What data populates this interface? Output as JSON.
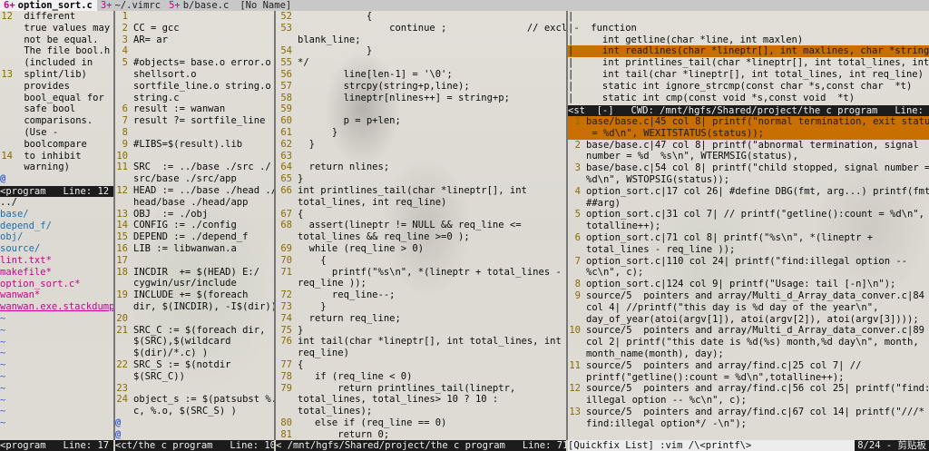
{
  "tabline": {
    "tabs": [
      {
        "num": "6+",
        "label": "option_sort.c",
        "selected": true
      },
      {
        "num": "3+",
        "label": "~/.vimrc",
        "selected": false
      },
      {
        "num": "5+",
        "label": "b/base.c",
        "selected": false
      },
      {
        "num": "",
        "label": "[No Name]",
        "selected": false
      }
    ]
  },
  "pane_doc": {
    "lines": [
      {
        "ln": "12",
        "text": " different"
      },
      {
        "ln": "",
        "text": " true values may"
      },
      {
        "ln": "",
        "text": " not be equal."
      },
      {
        "ln": "",
        "text": " The file bool.h"
      },
      {
        "ln": "",
        "text": " (included in"
      },
      {
        "ln": "13",
        "text": " splint/lib)"
      },
      {
        "ln": "",
        "text": " provides"
      },
      {
        "ln": "",
        "text": " bool_equal for"
      },
      {
        "ln": "",
        "text": " safe bool"
      },
      {
        "ln": "",
        "text": " comparisons."
      },
      {
        "ln": "",
        "text": " (Use -"
      },
      {
        "ln": "",
        "text": " boolcompare"
      },
      {
        "ln": "14",
        "text": " to inhibit"
      },
      {
        "ln": "",
        "text": " warning)"
      }
    ],
    "filler": "@",
    "status": "<program   Line: 12"
  },
  "pane_files": {
    "entries": [
      {
        "text": "../",
        "kind": "up"
      },
      {
        "text": "base/",
        "kind": "dir"
      },
      {
        "text": "depend_f/",
        "kind": "dir"
      },
      {
        "text": "obj/",
        "kind": "dir"
      },
      {
        "text": "source/",
        "kind": "dir"
      },
      {
        "text": "lint.txt*",
        "kind": "file"
      },
      {
        "text": "makefile*",
        "kind": "file"
      },
      {
        "text": "option_sort.c*",
        "kind": "file"
      },
      {
        "text": "wanwan*",
        "kind": "file"
      },
      {
        "text": "wanwan.exe.stackdump",
        "kind": "file-ul"
      }
    ],
    "tilde": "~",
    "status": "<program   Line: 17"
  },
  "pane_makefile": {
    "lines": [
      {
        "ln": "1",
        "text": ""
      },
      {
        "ln": "2",
        "text": "CC = gcc"
      },
      {
        "ln": "3",
        "text": "AR= ar"
      },
      {
        "ln": "4",
        "text": ""
      },
      {
        "ln": "5",
        "text": "#objects= base.o error.o"
      },
      {
        "ln": "",
        "text": "shellsort.o"
      },
      {
        "ln": "",
        "text": "sortfile_line.o string.o"
      },
      {
        "ln": "",
        "text": "string.c"
      },
      {
        "ln": "6",
        "text": "result := wanwan"
      },
      {
        "ln": "7",
        "text": "result ?= sortfile_line"
      },
      {
        "ln": "8",
        "text": ""
      },
      {
        "ln": "9",
        "text": "#LIBS=$(result).lib"
      },
      {
        "ln": "10",
        "text": ""
      },
      {
        "ln": "11",
        "text": "SRC  := ../base ./src ./"
      },
      {
        "ln": "",
        "text": "src/base ./src/app"
      },
      {
        "ln": "12",
        "text": "HEAD := ../base ./head ./"
      },
      {
        "ln": "",
        "text": "head/base ./head/app"
      },
      {
        "ln": "13",
        "text": "OBJ  := ./obj"
      },
      {
        "ln": "14",
        "text": "CONFIG := ./config"
      },
      {
        "ln": "15",
        "text": "DEPEND := ./depend_f"
      },
      {
        "ln": "16",
        "text": "LIB := libwanwan.a"
      },
      {
        "ln": "17",
        "text": ""
      },
      {
        "ln": "18",
        "text": "INCDIR  += $(HEAD) E:/"
      },
      {
        "ln": "",
        "text": "cygwin/usr/include"
      },
      {
        "ln": "19",
        "text": "INCLUDE += $(foreach"
      },
      {
        "ln": "",
        "text": "dir, $(INCDIR), -I$(dir))"
      },
      {
        "ln": "20",
        "text": ""
      },
      {
        "ln": "21",
        "text": "SRC_C := $(foreach dir,"
      },
      {
        "ln": "",
        "text": "$(SRC),$(wildcard"
      },
      {
        "ln": "",
        "text": "$(dir)/*.c) )"
      },
      {
        "ln": "22",
        "text": "SRC_S := $(notdir"
      },
      {
        "ln": "",
        "text": "$(SRC_C))"
      },
      {
        "ln": "23",
        "text": ""
      },
      {
        "ln": "24",
        "text": "object_s := $(patsubst %."
      },
      {
        "ln": "",
        "text": "c, %.o, $(SRC_S) )"
      }
    ],
    "filler": "@",
    "status": "<ct/the c program   Line: 10"
  },
  "pane_code": {
    "lines": [
      {
        "ln": "52",
        "text": "            {"
      },
      {
        "ln": "53",
        "text": "                continue ;              // exclude"
      },
      {
        "ln": "",
        "text": "blank_line;"
      },
      {
        "ln": "54",
        "text": "            }"
      },
      {
        "ln": "55",
        "text": "*/"
      },
      {
        "ln": "56",
        "text": "        line[len-1] = '\\0';"
      },
      {
        "ln": "57",
        "text": "        strcpy(string+p,line);"
      },
      {
        "ln": "58",
        "text": "        lineptr[nlines++] = string+p;"
      },
      {
        "ln": "59",
        "text": ""
      },
      {
        "ln": "60",
        "text": "        p = p+len;"
      },
      {
        "ln": "61",
        "text": "      }"
      },
      {
        "ln": "62",
        "text": "  }"
      },
      {
        "ln": "63",
        "text": ""
      },
      {
        "ln": "64",
        "text": "  return nlines;"
      },
      {
        "ln": "65",
        "text": "}"
      },
      {
        "ln": "66",
        "text": "int printlines_tail(char *lineptr[], int"
      },
      {
        "ln": "",
        "text": "total_lines, int req_line)"
      },
      {
        "ln": "67",
        "text": "{"
      },
      {
        "ln": "68",
        "text": "  assert(lineptr != NULL && req_line <="
      },
      {
        "ln": "",
        "text": "total_lines && req_line >=0 );"
      },
      {
        "ln": "69",
        "text": "  while (req_line > 0)"
      },
      {
        "ln": "70",
        "text": "    {"
      },
      {
        "ln": "71",
        "text": "      printf(\"%s\\n\", *(lineptr + total_lines -"
      },
      {
        "ln": "",
        "text": "req_line ));"
      },
      {
        "ln": "72",
        "text": "      req_line--;"
      },
      {
        "ln": "73",
        "text": "    }"
      },
      {
        "ln": "74",
        "text": "  return req_line;"
      },
      {
        "ln": "75",
        "text": "}"
      },
      {
        "ln": "76",
        "text": "int tail(char *lineptr[], int total_lines, int"
      },
      {
        "ln": "",
        "text": "req_line)"
      },
      {
        "ln": "77",
        "text": "{"
      },
      {
        "ln": "78",
        "text": "   if (req_line < 0)"
      },
      {
        "ln": "79",
        "text": "       return printlines_tail(lineptr,"
      },
      {
        "ln": "",
        "text": "total_lines, total_lines> 10 ? 10 :"
      },
      {
        "ln": "",
        "text": "total_lines);"
      },
      {
        "ln": "80",
        "text": "   else if (req_line == 0)"
      },
      {
        "ln": "81",
        "text": "       return 0;"
      }
    ],
    "status": "< /mnt/hgfs/Shared/project/the c program   Line: 71"
  },
  "pane_tags": {
    "lines": [
      {
        "text": "|",
        "hl": false
      },
      {
        "text": "|-  function",
        "hl": false
      },
      {
        "text": "|     int getline(char *line, int maxlen)",
        "hl": false
      },
      {
        "text": "|     int readlines(char *lineptr[], int maxlines, char *string)",
        "hl": true
      },
      {
        "text": "|     int printlines_tail(char *lineptr[], int total_lines, int",
        "hl": false
      },
      {
        "text": "|     int tail(char *lineptr[], int total_lines, int req_line)",
        "hl": false
      },
      {
        "text": "|     static int ignore_strcmp(const char *s,const char  *t)",
        "hl": false
      },
      {
        "text": "|     static int cmp(const void *s,const void  *t)",
        "hl": false
      }
    ],
    "status": "<st  [-]   CWD: /mnt/hgfs/Shared/project/the c program   Line: 2"
  },
  "pane_quickfix": {
    "lines": [
      {
        "ln": "1",
        "text": "base/base.c|45 col 8| printf(\"normal termination, exit status",
        "hl": true
      },
      {
        "ln": "",
        "text": " = %d\\n\", WEXITSTATUS(status));",
        "hl": true
      },
      {
        "ln": "2",
        "text": "base/base.c|47 col 8| printf(\"abnormal termination, signal",
        "hl": false
      },
      {
        "ln": "",
        "text": "number = %d  %s\\n\", WTERMSIG(status),",
        "hl": false
      },
      {
        "ln": "3",
        "text": "base/base.c|54 col 8| printf(\"child stopped, signal number =",
        "hl": false
      },
      {
        "ln": "",
        "text": "%d\\n\", WSTOPSIG(status));",
        "hl": false
      },
      {
        "ln": "4",
        "text": "option_sort.c|17 col 26| #define DBG(fmt, arg...) printf(fmt,",
        "hl": false
      },
      {
        "ln": "",
        "text": "##arg)",
        "hl": false
      },
      {
        "ln": "5",
        "text": "option_sort.c|31 col 7| // printf(\"getline():count = %d\\n\",",
        "hl": false
      },
      {
        "ln": "",
        "text": "totalline++);",
        "hl": false
      },
      {
        "ln": "6",
        "text": "option_sort.c|71 col 8| printf(\"%s\\n\", *(lineptr +",
        "hl": false
      },
      {
        "ln": "",
        "text": "total_lines - req_line ));",
        "hl": false
      },
      {
        "ln": "7",
        "text": "option_sort.c|110 col 24| printf(\"find:illegal option --",
        "hl": false
      },
      {
        "ln": "",
        "text": "%c\\n\", c);",
        "hl": false
      },
      {
        "ln": "8",
        "text": "option_sort.c|124 col 9| printf(\"Usage: tail [-n]\\n\");",
        "hl": false
      },
      {
        "ln": "9",
        "text": "source/5  pointers and array/Multi_d_Array_data_conver.c|84",
        "hl": false
      },
      {
        "ln": "",
        "text": "col 4| //printf(\"this day is %d day of the year\\n\",",
        "hl": false
      },
      {
        "ln": "",
        "text": "day_of_year(atoi(argv[1]), atoi(argv[2]), atoi(argv[3])));",
        "hl": false
      },
      {
        "ln": "10",
        "text": "source/5  pointers and array/Multi_d_Array_data_conver.c|89",
        "hl": false
      },
      {
        "ln": "",
        "text": "col 2| printf(\"this date is %d(%s) month,%d day\\n\", month,",
        "hl": false
      },
      {
        "ln": "",
        "text": "month_name(month), day);",
        "hl": false
      },
      {
        "ln": "11",
        "text": "source/5  pointers and array/find.c|25 col 7| //",
        "hl": false
      },
      {
        "ln": "",
        "text": "printf(\"getline():count = %d\\n\",totalline++);",
        "hl": false
      },
      {
        "ln": "12",
        "text": "source/5  pointers and array/find.c|56 col 25| printf(\"find:",
        "hl": false
      },
      {
        "ln": "",
        "text": "illegal option -- %c\\n\", c);",
        "hl": false
      },
      {
        "ln": "13",
        "text": "source/5  pointers and array/find.c|67 col 14| printf(\"///*",
        "hl": false
      },
      {
        "ln": "",
        "text": "find:illegal option*/ -\\n\");",
        "hl": false
      }
    ],
    "status": "[Quickfix List] :vim /\\<printf\\>",
    "status_right": "8/24 - 剪贴板"
  }
}
